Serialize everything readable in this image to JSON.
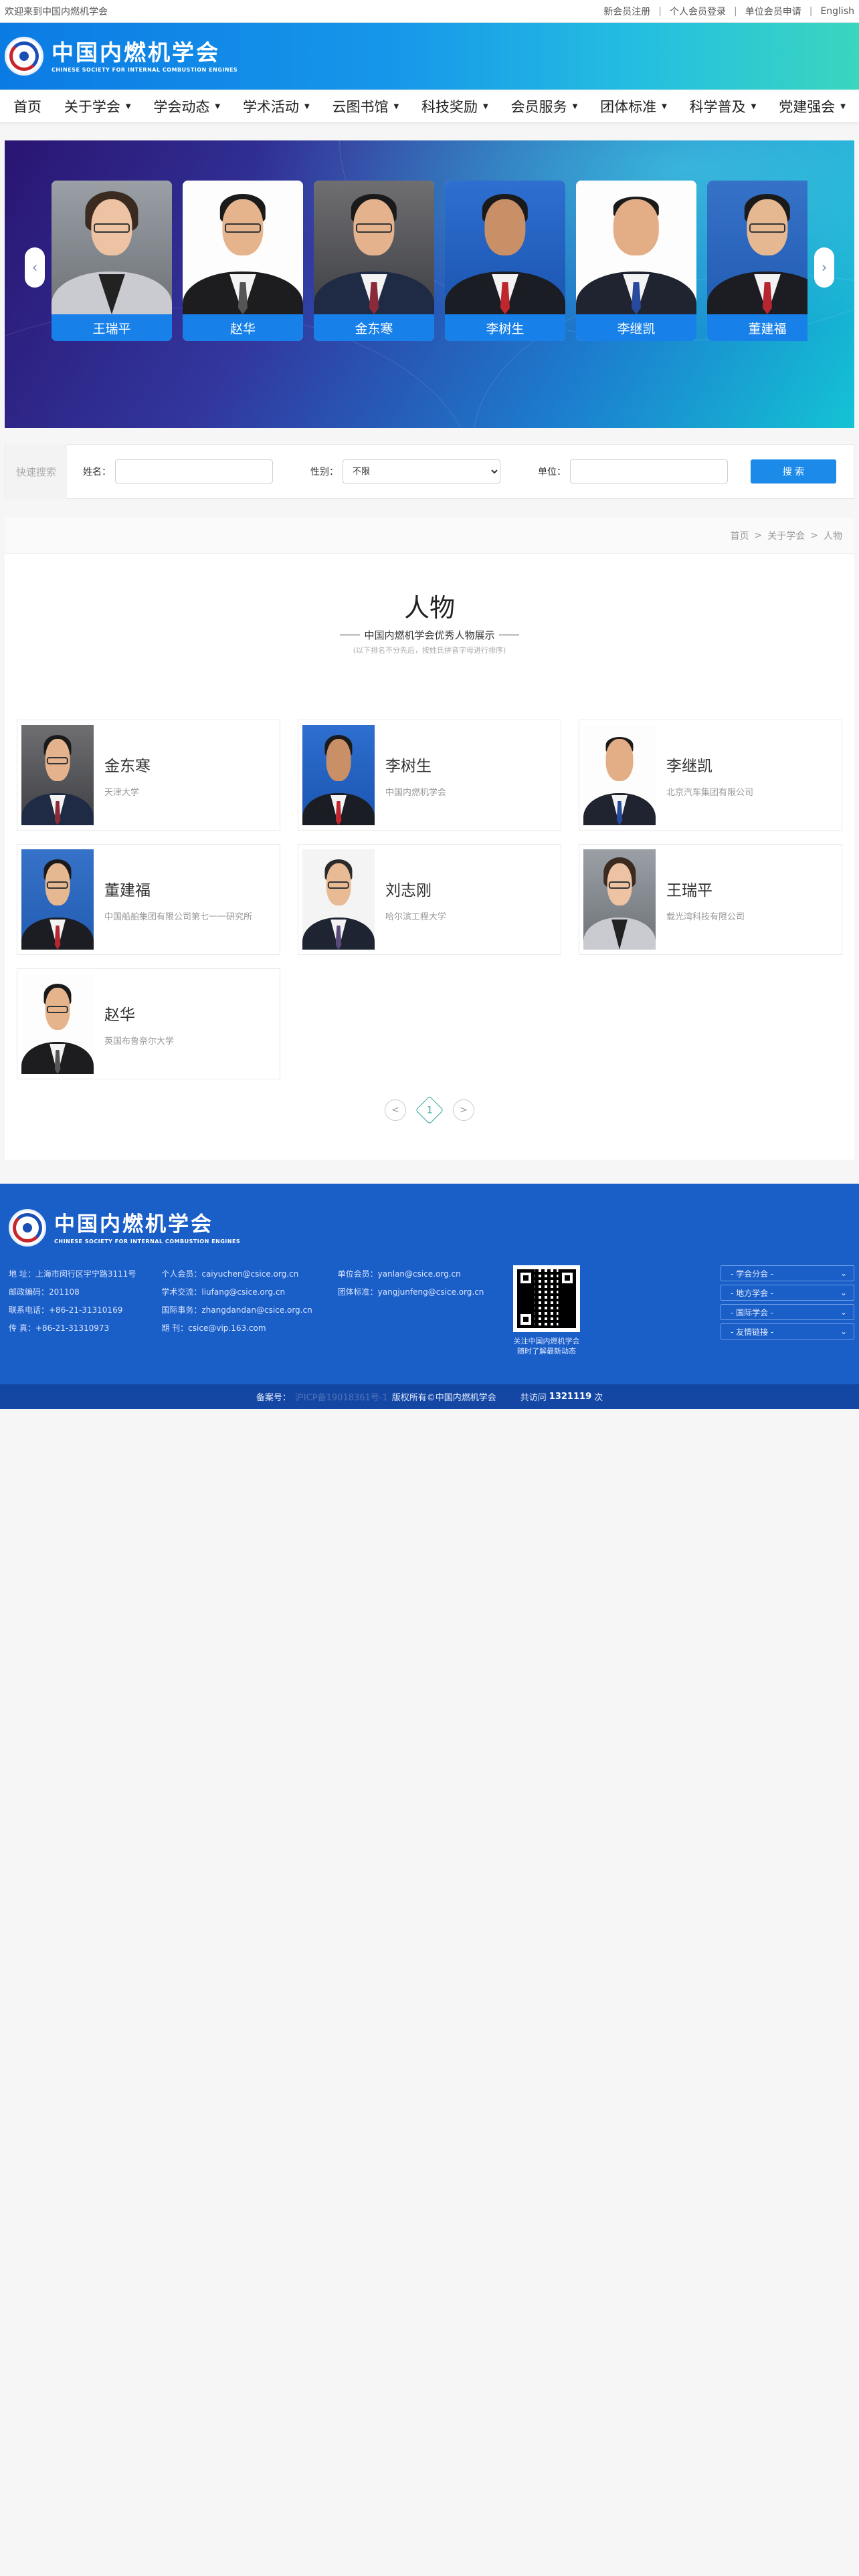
{
  "topbar": {
    "welcome": "欢迎来到中国内燃机学会",
    "links": [
      "新会员注册",
      "个人会员登录",
      "单位会员申请",
      "English"
    ]
  },
  "logo": {
    "cn": "中国内燃机学会",
    "en": "CHINESE SOCIETY FOR INTERNAL COMBUSTION ENGINES"
  },
  "nav": [
    {
      "label": "首页",
      "dropdown": false
    },
    {
      "label": "关于学会",
      "dropdown": true
    },
    {
      "label": "学会动态",
      "dropdown": true
    },
    {
      "label": "学术活动",
      "dropdown": true
    },
    {
      "label": "云图书馆",
      "dropdown": true
    },
    {
      "label": "科技奖励",
      "dropdown": true
    },
    {
      "label": "会员服务",
      "dropdown": true
    },
    {
      "label": "团体标准",
      "dropdown": true
    },
    {
      "label": "科学普及",
      "dropdown": true
    },
    {
      "label": "党建强会",
      "dropdown": true
    }
  ],
  "banner": {
    "prev_icon": "chevron-left-icon",
    "next_icon": "chevron-right-icon",
    "cards": [
      {
        "name": "王瑞平"
      },
      {
        "name": "赵华"
      },
      {
        "name": "金东寒"
      },
      {
        "name": "李树生"
      },
      {
        "name": "李继凯"
      },
      {
        "name": "董建福"
      }
    ]
  },
  "search": {
    "tag": "快速搜索",
    "name_label": "姓名：",
    "name_value": "",
    "gender_label": "性别：",
    "gender_value": "不限",
    "org_label": "单位：",
    "org_value": "",
    "button": "搜 索"
  },
  "breadcrumb": [
    "首页",
    "关于学会",
    "人物"
  ],
  "heading": {
    "title": "人物",
    "subtitle": "中国内燃机学会优秀人物展示",
    "note": "(以下排名不分先后，按姓氏拼音字母进行排序)"
  },
  "people": [
    {
      "name": "金东寒",
      "org": "天津大学"
    },
    {
      "name": "李树生",
      "org": "中国内燃机学会"
    },
    {
      "name": "李继凯",
      "org": "北京汽车集团有限公司"
    },
    {
      "name": "董建福",
      "org": "中国船舶集团有限公司第七一一研究所"
    },
    {
      "name": "刘志刚",
      "org": "哈尔滨工程大学"
    },
    {
      "name": "王瑞平",
      "org": "载光湾科技有限公司"
    },
    {
      "name": "赵华",
      "org": "英国布鲁奈尔大学"
    }
  ],
  "pager": {
    "prev": "<",
    "current": "1",
    "next": ">"
  },
  "footer": {
    "col1": [
      "地    址：上海市闵行区宇宁路3111号",
      "邮政编码：201108",
      "联系电话：+86-21-31310169",
      "传    真：+86-21-31310973"
    ],
    "col2": [
      "个人会员：caiyuchen@csice.org.cn",
      "学术交流：liufang@csice.org.cn",
      "国际事务：zhangdandan@csice.org.cn",
      "期    刊：csice@vip.163.com"
    ],
    "col3": [
      "单位会员：yanlan@csice.org.cn",
      "团体标准：yangjunfeng@csice.org.cn"
    ],
    "qr_caption": [
      "关注中国内燃机学会",
      "随时了解最新动态"
    ],
    "selects": [
      "- 学会分会 -",
      "- 地方学会 -",
      "- 国际学会 -",
      "- 友情链接 -"
    ],
    "icp_label": "备案号：",
    "icp_value": "沪ICP备19018361号-1",
    "copyright": "版权所有©中国内燃机学会",
    "visits_prefix": "共访问",
    "visits_count": "1321119",
    "visits_suffix": "次"
  }
}
